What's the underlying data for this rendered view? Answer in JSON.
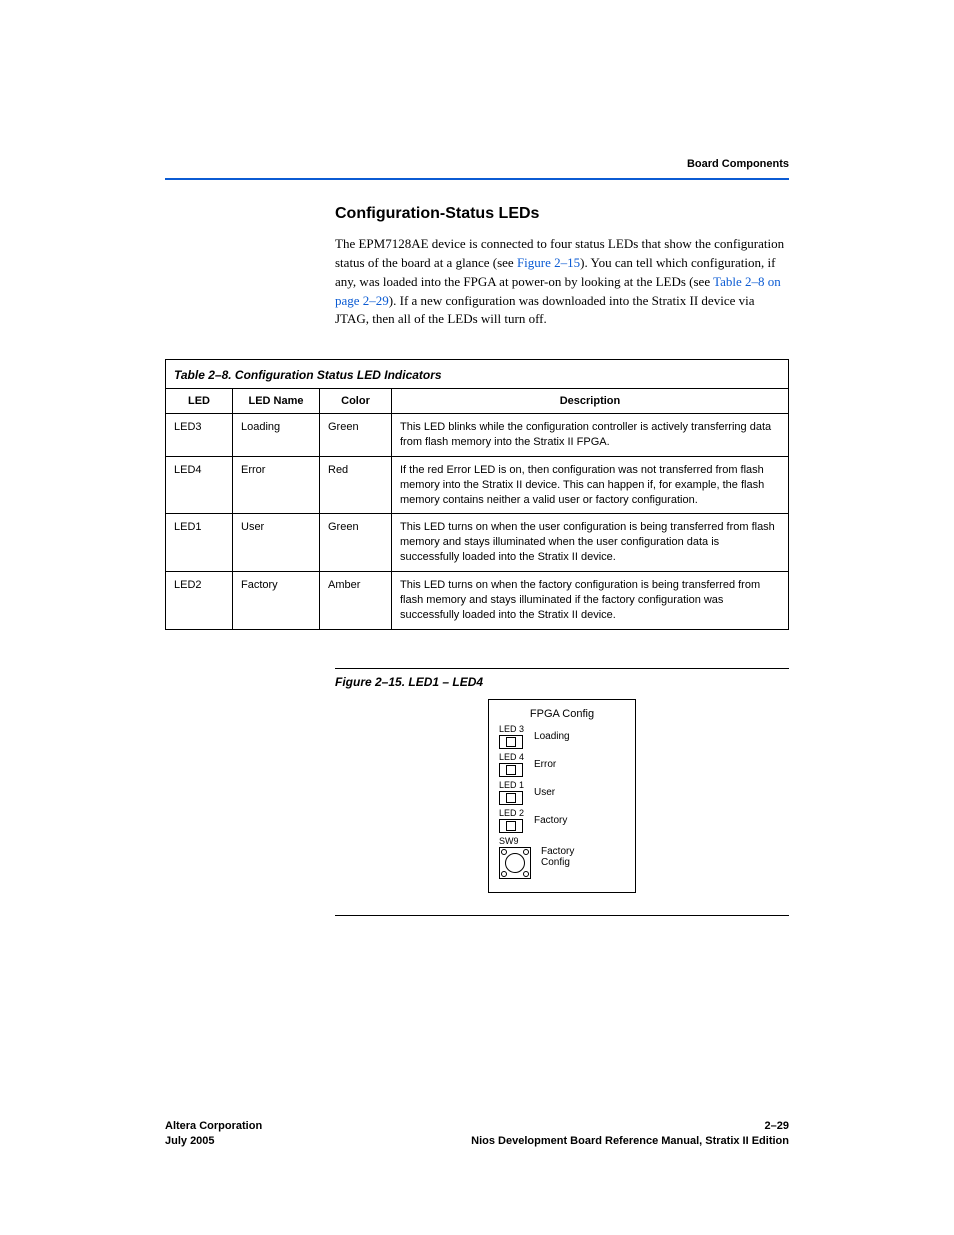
{
  "running_head": "Board Components",
  "section_title": "Configuration-Status LEDs",
  "intro": {
    "part1": "The EPM7128AE device is connected to four status LEDs that show the configuration status of the board at a glance (see ",
    "link1": "Figure 2–15",
    "part2": "). You can tell which configuration, if any, was loaded into the FPGA at power-on by looking at the LEDs (see ",
    "link2": "Table 2–8 on page 2–29",
    "part3": "). If a new configuration was downloaded into the Stratix II device via JTAG, then all of the LEDs will turn off."
  },
  "table": {
    "caption": "Table 2–8. Configuration Status LED Indicators",
    "headers": [
      "LED",
      "LED Name",
      "Color",
      "Description"
    ],
    "rows": [
      {
        "led": "LED3",
        "name": "Loading",
        "color": "Green",
        "desc": "This LED blinks while the configuration controller is actively transferring data from flash memory into the Stratix II FPGA."
      },
      {
        "led": "LED4",
        "name": "Error",
        "color": "Red",
        "desc": "If the red Error LED is on, then configuration was not transferred from flash memory into the Stratix II device. This can happen if, for example, the flash memory contains neither a valid user or factory configuration."
      },
      {
        "led": "LED1",
        "name": "User",
        "color": "Green",
        "desc": "This LED turns on when the user configuration is being transferred from flash memory and stays illuminated when the user configuration data is successfully loaded into the Stratix II device."
      },
      {
        "led": "LED2",
        "name": "Factory",
        "color": "Amber",
        "desc": "This LED turns on when the factory configuration is being transferred from flash memory and stays illuminated if the factory configuration was successfully loaded into the Stratix II device."
      }
    ]
  },
  "figure": {
    "caption": "Figure 2–15. LED1 – LED4",
    "title": "FPGA Config",
    "items": [
      {
        "tag": "LED 3",
        "label": "Loading"
      },
      {
        "tag": "LED 4",
        "label": "Error"
      },
      {
        "tag": "LED 1",
        "label": "User"
      },
      {
        "tag": "LED 2",
        "label": "Factory"
      }
    ],
    "sw": {
      "tag": "SW9",
      "label1": "Factory",
      "label2": "Config"
    }
  },
  "footer": {
    "left1": "Altera Corporation",
    "left2": "July 2005",
    "right1": "2–29",
    "right2": "Nios Development Board Reference Manual, Stratix II Edition"
  }
}
